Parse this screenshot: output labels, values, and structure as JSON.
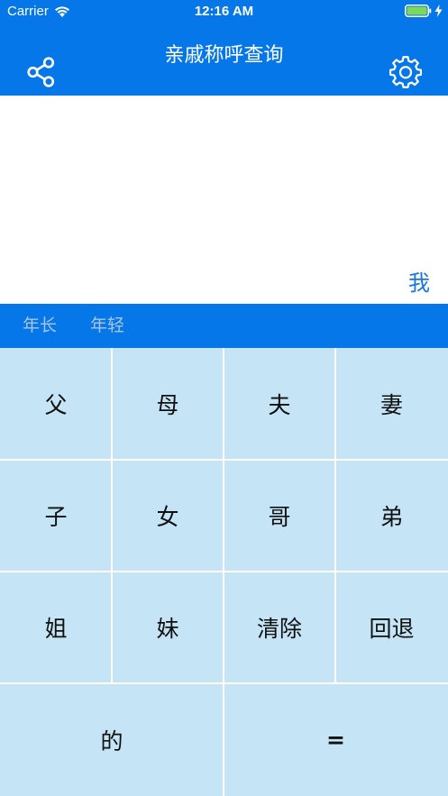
{
  "status_bar": {
    "carrier": "Carrier",
    "time": "12:16 AM",
    "battery_color": "#7ed957"
  },
  "nav": {
    "title": "亲戚称呼查询",
    "left_icon": "share-icon",
    "right_icon": "gear-icon"
  },
  "display": {
    "current": "我"
  },
  "age_tabs": {
    "older": "年长",
    "younger": "年轻"
  },
  "keys": {
    "row1": [
      "父",
      "母",
      "夫",
      "妻"
    ],
    "row2": [
      "子",
      "女",
      "哥",
      "弟"
    ],
    "row3": [
      "姐",
      "妹",
      "清除",
      "回退"
    ],
    "row4": [
      "的",
      "="
    ]
  },
  "colors": {
    "primary": "#0677e8",
    "keypad": "#c5e4f5",
    "accent_text": "#1577e0",
    "inactive_tab": "#a9c4e4"
  }
}
